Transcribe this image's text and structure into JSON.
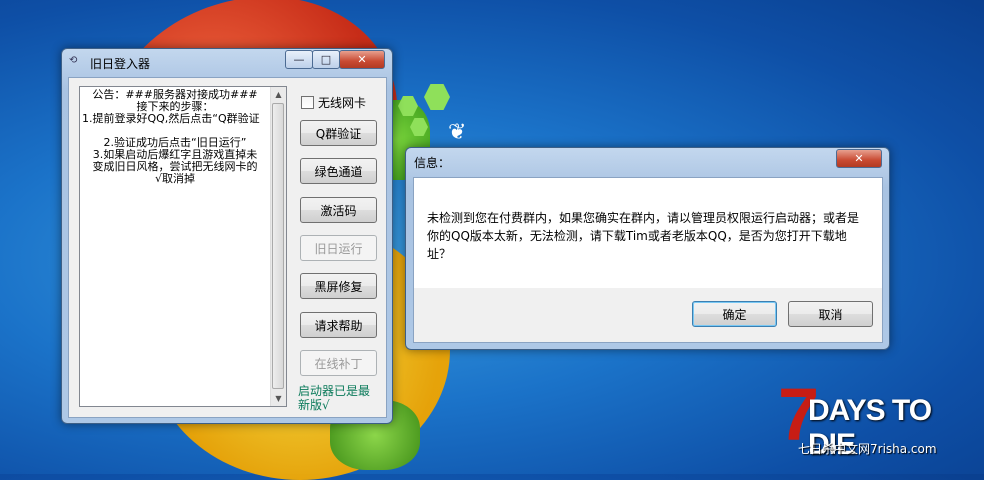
{
  "app_window": {
    "title": "旧日登入器",
    "minimize_glyph": "—",
    "maximize_glyph": "□",
    "close_glyph": "✕",
    "notice_lines": [
      "公告：###服务器对接成功###",
      "接下来的步骤：",
      "1.提前登录好QQ,然后点击“Q群验证",
      "",
      "2.验证成功后点击“旧日运行”",
      "3.如果启动后爆红字且游戏直掉未",
      "变成旧日风格，尝试把无线网卡的",
      "√取消掉"
    ],
    "checkbox_label": "无线网卡",
    "checkbox_checked": false,
    "buttons": [
      {
        "label": "Q群验证",
        "enabled": true
      },
      {
        "label": "绿色通道",
        "enabled": true
      },
      {
        "label": "激活码",
        "enabled": true
      },
      {
        "label": "旧日运行",
        "enabled": false
      },
      {
        "label": "黑屏修复",
        "enabled": true
      },
      {
        "label": "请求帮助",
        "enabled": true
      },
      {
        "label": "在线补丁",
        "enabled": false
      }
    ],
    "status": "启动器已是最新版√"
  },
  "message_box": {
    "title": "信息：",
    "close_glyph": "✕",
    "message": "未检测到您在付费群内，如果您确实在群内，请以管理员权限运行启动器；或者是你的QQ版本太新，无法检测，请下载Tim或者老版本QQ，是否为您打开下载地址？",
    "ok_label": "确定",
    "cancel_label": "取消"
  },
  "watermark": {
    "logo_digit": "7",
    "logo_text": "DAYS TO DIE",
    "site_text": "七日杀中文网7risha.com"
  },
  "colors": {
    "desktop": "#1b73c9",
    "status_text": "#0a7a5a",
    "logo_red": "#c71d14"
  }
}
